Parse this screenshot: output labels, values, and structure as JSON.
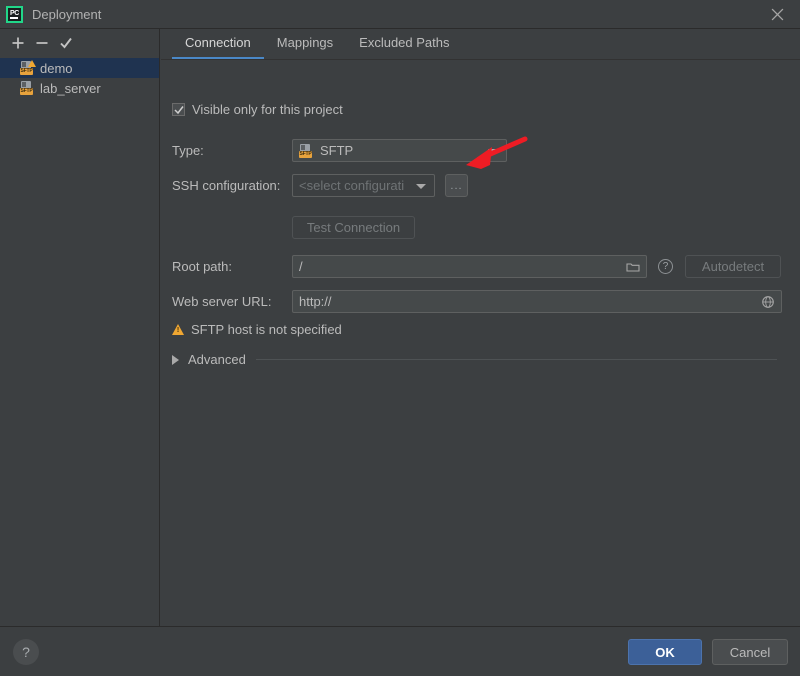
{
  "window": {
    "title": "Deployment",
    "app_icon": "pycharm-logo",
    "close_icon": "close-icon"
  },
  "sidebar": {
    "toolbar": [
      {
        "name": "add-button",
        "icon": "plus-icon",
        "label": "+"
      },
      {
        "name": "remove-button",
        "icon": "minus-icon",
        "label": "−"
      },
      {
        "name": "set-default-button",
        "icon": "check-icon",
        "label": "✓"
      }
    ],
    "items": [
      {
        "label": "demo",
        "icon": "sftp-server-warning-icon",
        "tag": "SFTP",
        "selected": true,
        "warning": true
      },
      {
        "label": "lab_server",
        "icon": "sftp-server-icon",
        "tag": "SFTP",
        "selected": false,
        "warning": false
      }
    ]
  },
  "tabs": [
    {
      "label": "Connection",
      "active": true
    },
    {
      "label": "Mappings",
      "active": false
    },
    {
      "label": "Excluded Paths",
      "active": false
    }
  ],
  "connection": {
    "visible_only_checkbox": {
      "label": "Visible only for this project",
      "checked": true
    },
    "type": {
      "label": "Type:",
      "value": "SFTP",
      "icon": "sftp-icon"
    },
    "ssh_configuration": {
      "label": "SSH configuration:",
      "value": "<select configurati",
      "placeholder": "<select configuration>",
      "browse_button": "...",
      "disabled": true
    },
    "test_connection": {
      "label": "Test Connection",
      "disabled": true
    },
    "root_path": {
      "label": "Root path:",
      "value": "/",
      "browse_icon": "folder-icon",
      "help_icon": "question-circle-icon",
      "autodetect": {
        "label": "Autodetect",
        "disabled": true
      }
    },
    "web_server_url": {
      "label": "Web server URL:",
      "value": "http://",
      "open_icon": "globe-icon"
    },
    "warning": {
      "icon": "warning-triangle-icon",
      "text": "SFTP host is not specified"
    },
    "advanced": {
      "label": "Advanced",
      "expanded": false,
      "icon": "chevron-right-icon"
    }
  },
  "footer": {
    "help": {
      "label": "?",
      "icon": "question-icon"
    },
    "ok": {
      "label": "OK"
    },
    "cancel": {
      "label": "Cancel"
    }
  },
  "annotation": {
    "type": "arrow",
    "color": "#ee1c24",
    "points_to": "ssh-configuration-browse-button"
  },
  "colors": {
    "background": "#3c3f41",
    "selection": "#1f3350",
    "accent": "#4a88c7",
    "primary_button": "#3c6098",
    "warning": "#f0a732",
    "annotation": "#ee1c24"
  }
}
